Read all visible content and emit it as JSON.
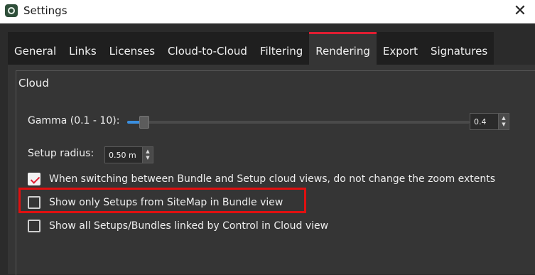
{
  "window": {
    "title": "Settings",
    "close_glyph": "✕",
    "icon": "settings-app-icon"
  },
  "tabs": [
    {
      "label": "General",
      "active": false
    },
    {
      "label": "Links",
      "active": false
    },
    {
      "label": "Licenses",
      "active": false
    },
    {
      "label": "Cloud-to-Cloud",
      "active": false
    },
    {
      "label": "Filtering",
      "active": false
    },
    {
      "label": "Rendering",
      "active": true
    },
    {
      "label": "Export",
      "active": false
    },
    {
      "label": "Signatures",
      "active": false
    }
  ],
  "group": {
    "title": "Cloud"
  },
  "gamma": {
    "label": "Gamma (0.1 - 10):",
    "value": "0.4",
    "slider_fraction": 0.04
  },
  "setup_radius": {
    "label": "Setup radius:",
    "value": "0.50 m"
  },
  "options": [
    {
      "label": "When switching between Bundle and Setup cloud views, do not change the zoom extents",
      "checked": true
    },
    {
      "label": "Show only Setups from SiteMap in Bundle view",
      "checked": false,
      "highlighted": true
    },
    {
      "label": "Show all Setups/Bundles linked by Control in Cloud view",
      "checked": false
    }
  ],
  "colors": {
    "accent": "#e01e32",
    "highlight": "#e01010",
    "slider": "#3a8fe0"
  }
}
